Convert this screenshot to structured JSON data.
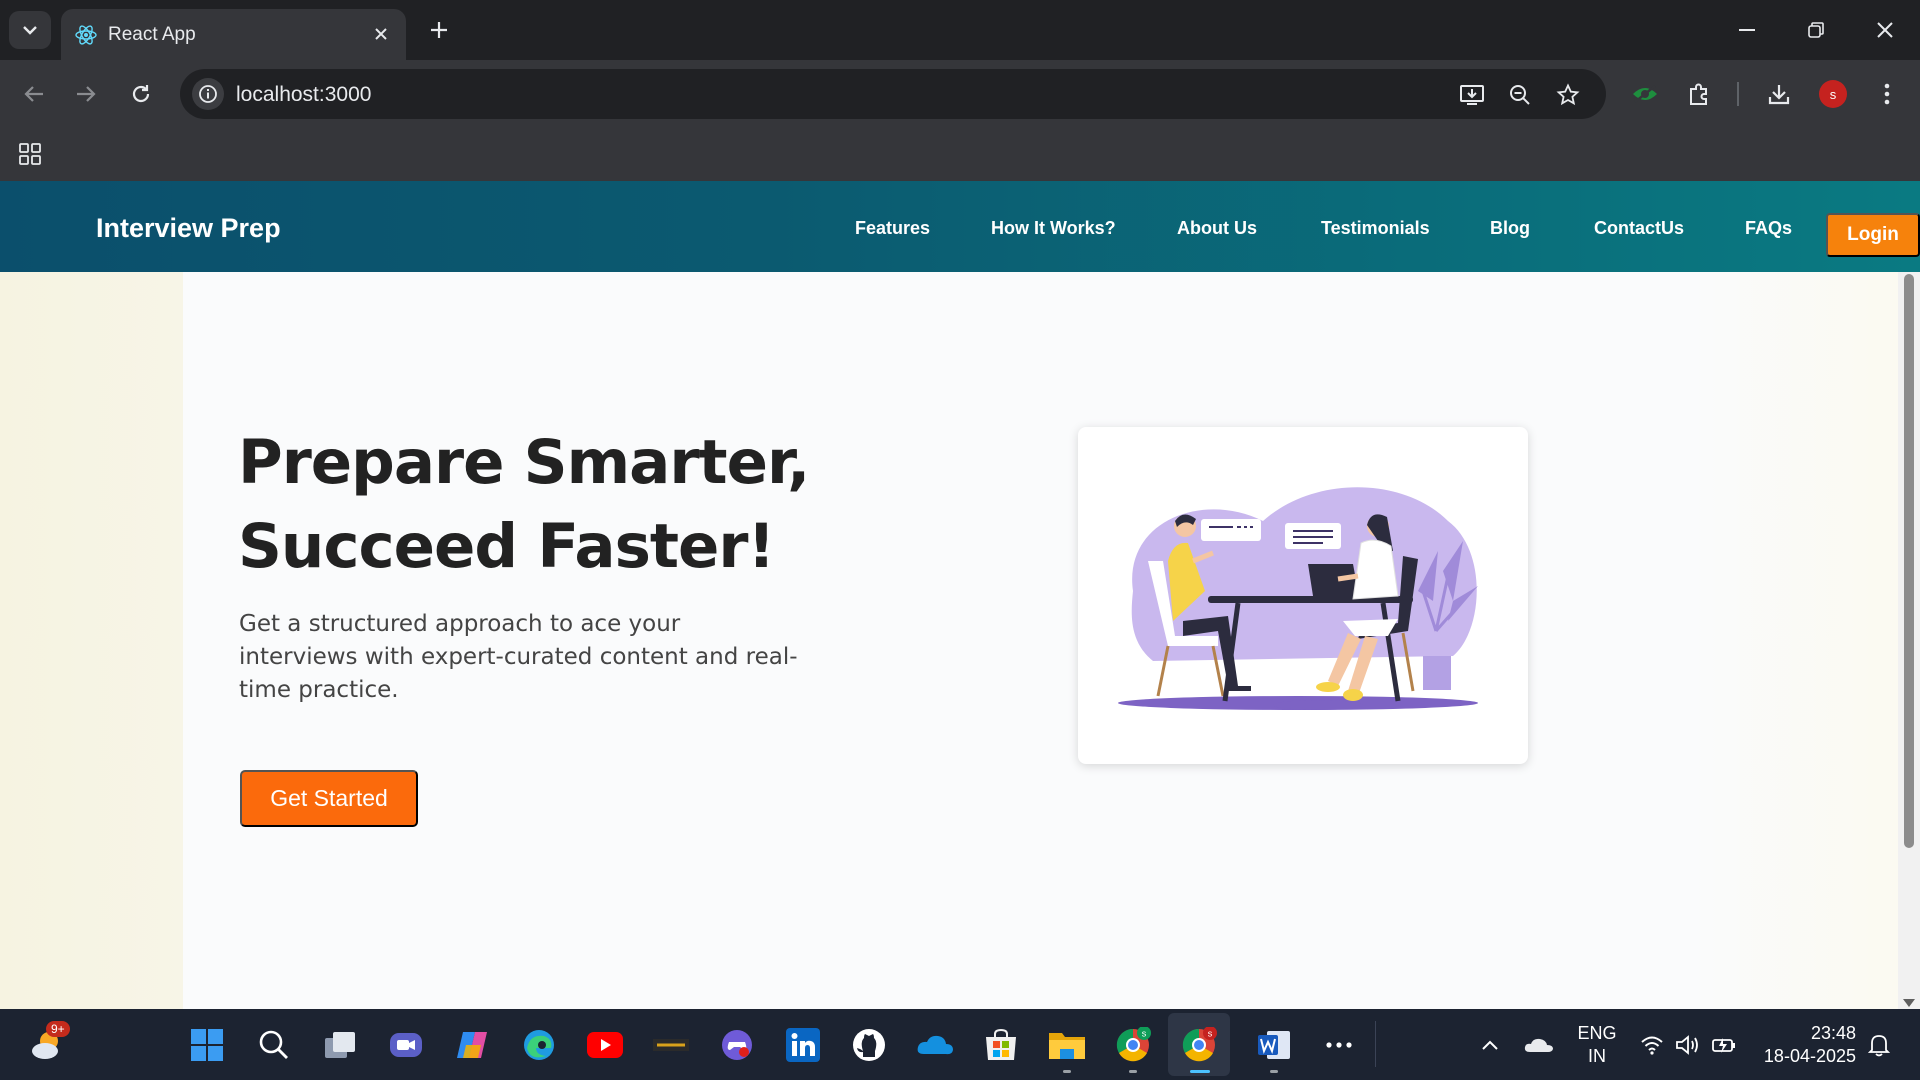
{
  "browser": {
    "tab_title": "React App",
    "url": "localhost:3000",
    "profile_initial": "s"
  },
  "site": {
    "brand": "Interview Prep",
    "nav": [
      "Features",
      "How It Works?",
      "About Us",
      "Testimonials",
      "Blog",
      "ContactUs",
      "FAQs"
    ],
    "login_label": "Login"
  },
  "hero": {
    "title_line1": "Prepare Smarter,",
    "title_line2": "Succeed Faster!",
    "description": "Get a structured approach to ace your interviews with expert-curated content and real-time practice.",
    "cta_label": "Get Started"
  },
  "taskbar": {
    "weather_badge": "9+",
    "language_line1": "ENG",
    "language_line2": "IN",
    "time": "23:48",
    "date": "18-04-2025"
  },
  "colors": {
    "header_start": "#0b4f6c",
    "header_end": "#0a7a82",
    "login_button": "#f6820c",
    "cta_button": "#fb6a0c",
    "illustration_purple": "#c9b8ee"
  }
}
